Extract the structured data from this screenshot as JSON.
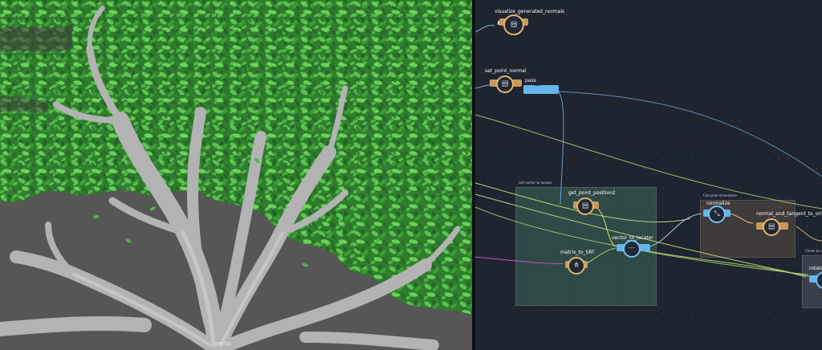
{
  "viewport": {
    "camera_label": "persp"
  },
  "graph": {
    "backdrops": [
      {
        "title": "Get vector to locator"
      },
      {
        "title": "Calculate Orientation"
      },
      {
        "title": "Check to s"
      }
    ],
    "nodes": {
      "visualize_generated_normals": "visualize_generated_normals",
      "set_point_normal": "set_point_normal",
      "pass": "pass",
      "get_point_position2": "get_point_position2",
      "matrix_to_SRT": "matrix_to_SRT",
      "vector_to_locator": "vector_to_locator",
      "normalize": "normalize",
      "normal_and_tangent": "normal_and_tangent_to_orientati",
      "rotate": "rotate"
    }
  },
  "colors": {
    "graph_bg": "#1e2430",
    "compound_node": "#c79a5a",
    "native_node": "#62b6ea",
    "foliage": "#3f9a3a",
    "branch": "#b5b5b5"
  },
  "icons": {
    "compound": "document-icon",
    "pass": "arrow-icon",
    "matrix_to_SRT": "fork-icon",
    "normalize": "scale-icon"
  }
}
